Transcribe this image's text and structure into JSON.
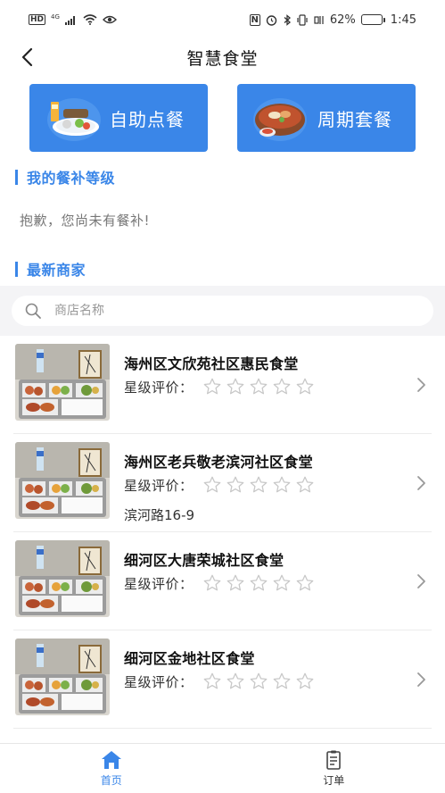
{
  "status_bar": {
    "left_badges": [
      "HD",
      "4G"
    ],
    "nfc": "N",
    "battery": "62%",
    "battery_level": 0.62,
    "time": "1:45"
  },
  "header": {
    "title": "智慧食堂"
  },
  "features": [
    {
      "label": "自助点餐",
      "icon": "meal-tray-icon"
    },
    {
      "label": "周期套餐",
      "icon": "hotpot-icon"
    }
  ],
  "subsidy": {
    "title": "我的餐补等级",
    "empty_text": "抱歉，您尚未有餐补!"
  },
  "merchants": {
    "title": "最新商家"
  },
  "search": {
    "placeholder": "商店名称",
    "value": ""
  },
  "shops": [
    {
      "name": "海州区文欣苑社区惠民食堂",
      "rating_label": "星级评价：",
      "rating": 0,
      "address": ""
    },
    {
      "name": "海州区老兵敬老滨河社区食堂",
      "rating_label": "星级评价：",
      "rating": 0,
      "address": "滨河路16-9"
    },
    {
      "name": "细河区大唐荣城社区食堂",
      "rating_label": "星级评价：",
      "rating": 0,
      "address": ""
    },
    {
      "name": "细河区金地社区食堂",
      "rating_label": "星级评价：",
      "rating": 0,
      "address": ""
    }
  ],
  "tabs": [
    {
      "label": "首页",
      "icon": "home-icon",
      "active": true
    },
    {
      "label": "订单",
      "icon": "order-clipboard-icon",
      "active": false
    }
  ],
  "colors": {
    "accent": "#3a86e8",
    "star_outline": "#c8c8c8",
    "search_bg": "#f4f4f6"
  }
}
